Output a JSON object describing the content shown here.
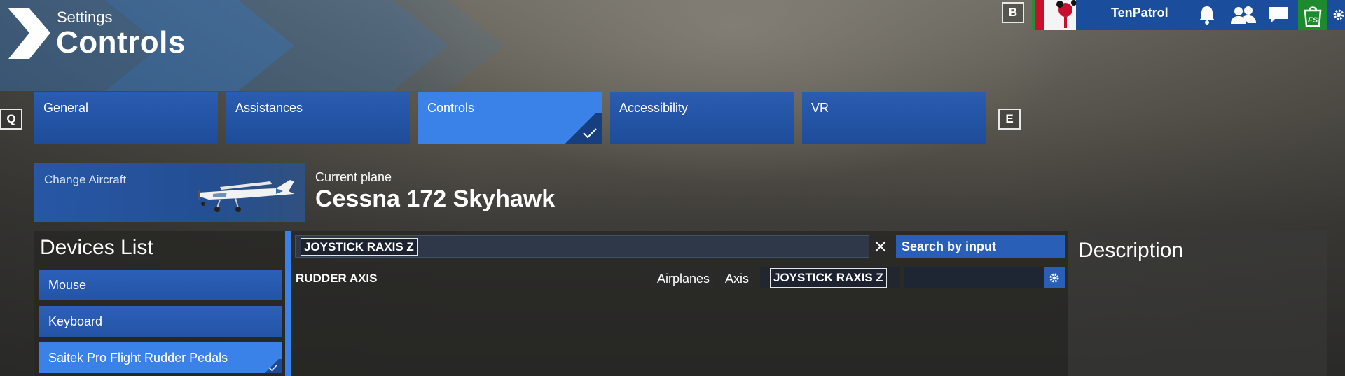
{
  "header": {
    "subtitle": "Settings",
    "title": "Controls"
  },
  "top_bar": {
    "back_key": "B",
    "username": "TenPatrol",
    "icons": [
      "bell-icon",
      "friends-icon",
      "chat-icon",
      "marketplace-icon",
      "settings-icon"
    ],
    "shop_label": "FS"
  },
  "tabs": {
    "prev_key": "Q",
    "next_key": "E",
    "items": [
      {
        "label": "General",
        "active": false
      },
      {
        "label": "Assistances",
        "active": false
      },
      {
        "label": "Controls",
        "active": true
      },
      {
        "label": "Accessibility",
        "active": false
      },
      {
        "label": "VR",
        "active": false
      }
    ]
  },
  "aircraft": {
    "change_label": "Change Aircraft",
    "current_label": "Current plane",
    "current_value": "Cessna 172 Skyhawk"
  },
  "devices": {
    "title": "Devices List",
    "items": [
      {
        "label": "Mouse",
        "selected": false
      },
      {
        "label": "Keyboard",
        "selected": false
      },
      {
        "label": "Saitek Pro Flight Rudder Pedals",
        "selected": true
      }
    ]
  },
  "search": {
    "query": "JOYSTICK RAXIS Z",
    "button_label": "Search by input"
  },
  "binding": {
    "name": "RUDDER AXIS",
    "category": "Airplanes",
    "type": "Axis",
    "input": "JOYSTICK RAXIS Z"
  },
  "description": {
    "title": "Description"
  },
  "colors": {
    "accent_blue": "#3b82e8",
    "tab_blue": "#1e4c9a",
    "profile_bar": "#1a4e9c"
  }
}
